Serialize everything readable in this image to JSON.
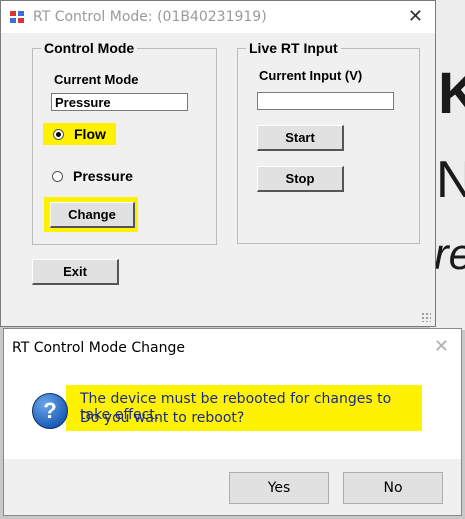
{
  "background_app": {
    "glyphs": [
      "Ks",
      "N",
      "re"
    ]
  },
  "main_window": {
    "title": "RT Control Mode: (01B40231919)",
    "close_glyph": "✕",
    "control_mode": {
      "group_title": "Control Mode",
      "current_mode_label": "Current Mode",
      "current_mode_value": "Pressure",
      "radio_flow_label": "Flow",
      "radio_flow_selected": true,
      "radio_pressure_label": "Pressure",
      "change_button": "Change"
    },
    "live_rt_input": {
      "group_title": "Live RT Input",
      "current_input_label": "Current Input (V)",
      "current_input_value": "",
      "start_button": "Start",
      "stop_button": "Stop"
    },
    "exit_button": "Exit",
    "highlight_color": "#fff200"
  },
  "dialog": {
    "title": "RT Control Mode Change",
    "close_glyph": "✕",
    "icon": "question-icon",
    "message_line1": "The device must be rebooted for changes to take effect.",
    "message_line2": "Do you want to reboot?",
    "yes_button": "Yes",
    "no_button": "No"
  }
}
